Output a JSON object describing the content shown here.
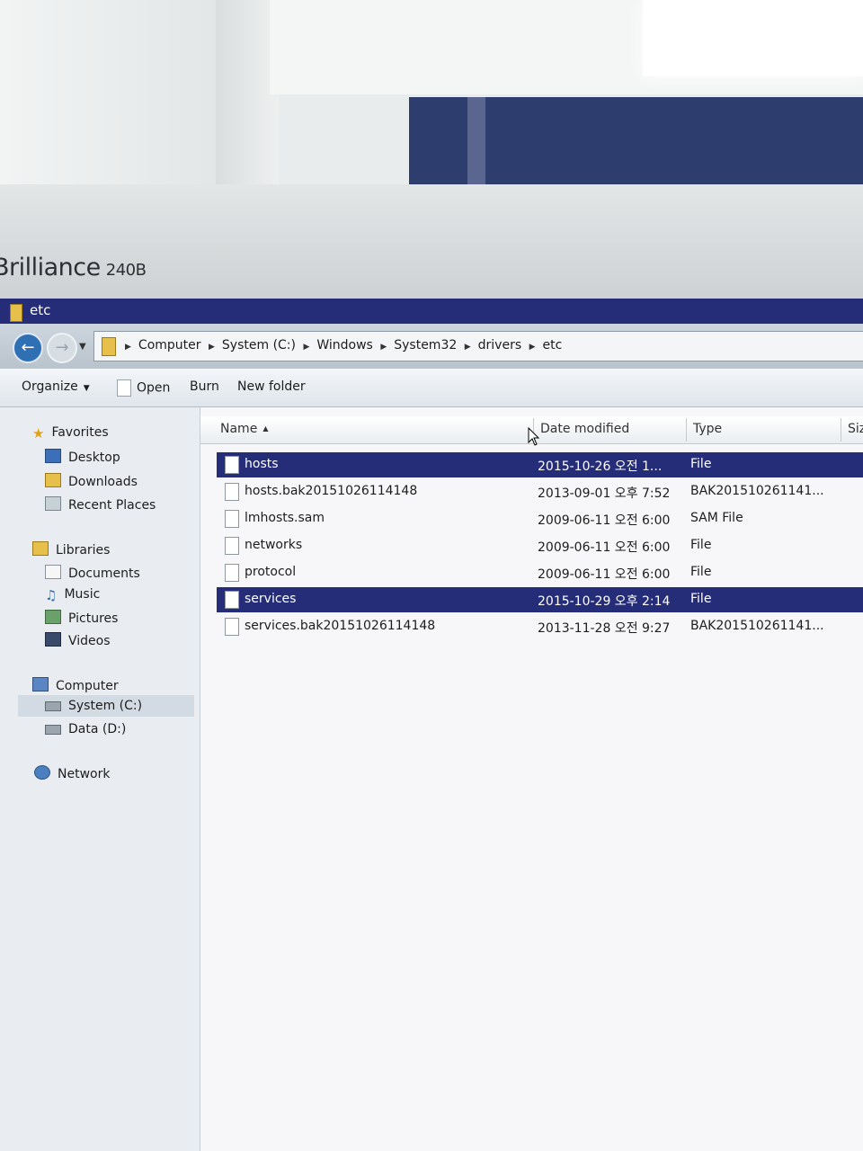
{
  "monitor": {
    "brand": "Brilliance",
    "model": "240B"
  },
  "window": {
    "title": "etc"
  },
  "address": {
    "crumbs": [
      "Computer",
      "System (C:)",
      "Windows",
      "System32",
      "drivers",
      "etc"
    ]
  },
  "toolbar": {
    "organize_label": "Organize",
    "open_label": "Open",
    "burn_label": "Burn",
    "new_folder_label": "New folder"
  },
  "nav": {
    "favorites": "Favorites",
    "desktop": "Desktop",
    "downloads": "Downloads",
    "recent_places": "Recent Places",
    "libraries": "Libraries",
    "documents": "Documents",
    "music": "Music",
    "pictures": "Pictures",
    "videos": "Videos",
    "computer": "Computer",
    "system_c": "System (C:)",
    "data_d": "Data (D:)",
    "network": "Network"
  },
  "columns": {
    "name": "Name",
    "date_modified": "Date modified",
    "type": "Type",
    "size": "Siz"
  },
  "files": [
    {
      "name": "hosts",
      "date": "2015-10-26 오전 1...",
      "type": "File",
      "selected": true
    },
    {
      "name": "hosts.bak20151026114148",
      "date": "2013-09-01 오후 7:52",
      "type": "BAK201510261141...",
      "selected": false
    },
    {
      "name": "lmhosts.sam",
      "date": "2009-06-11 오전 6:00",
      "type": "SAM File",
      "selected": false
    },
    {
      "name": "networks",
      "date": "2009-06-11 오전 6:00",
      "type": "File",
      "selected": false
    },
    {
      "name": "protocol",
      "date": "2009-06-11 오전 6:00",
      "type": "File",
      "selected": false
    },
    {
      "name": "services",
      "date": "2015-10-29 오후 2:14",
      "type": "File",
      "selected": true
    },
    {
      "name": "services.bak20151026114148",
      "date": "2013-11-28 오전 9:27",
      "type": "BAK201510261141...",
      "selected": false
    }
  ],
  "colors": {
    "selection": "#262d78",
    "titlebar": "#262d78"
  }
}
